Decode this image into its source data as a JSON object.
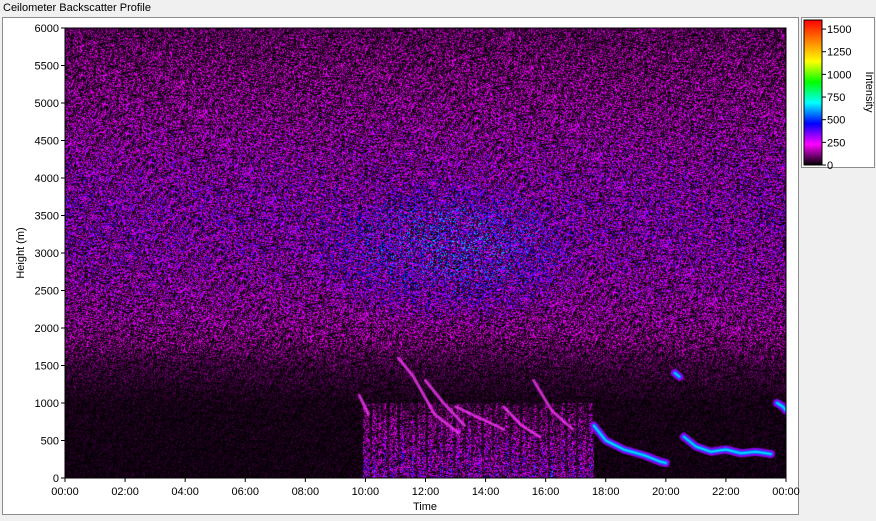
{
  "window": {
    "title": "Ceilometer Backscatter Profile"
  },
  "chart_data": {
    "type": "heatmap",
    "title": "",
    "xlabel": "Time",
    "ylabel": "Height (m)",
    "x_ticks": [
      "00:00",
      "02:00",
      "04:00",
      "06:00",
      "08:00",
      "10:00",
      "12:00",
      "14:00",
      "16:00",
      "18:00",
      "20:00",
      "22:00",
      "00:00"
    ],
    "y_ticks": [
      0,
      500,
      1000,
      1500,
      2000,
      2500,
      3000,
      3500,
      4000,
      4500,
      5000,
      5500,
      6000
    ],
    "xlim": [
      0,
      24
    ],
    "ylim": [
      0,
      6000
    ],
    "grid": false,
    "colorbar": {
      "label": "Intensity",
      "ticks": [
        0,
        250,
        500,
        750,
        1000,
        1250,
        1500
      ],
      "range": [
        0,
        1600
      ],
      "colors": [
        "#000000",
        "#ff00ff",
        "#0000ff",
        "#00ffff",
        "#00ff00",
        "#ffff00",
        "#ff8000",
        "#ff0000"
      ]
    },
    "features": {
      "background_level_by_height": [
        [
          0,
          20
        ],
        [
          1000,
          25
        ],
        [
          1500,
          60
        ],
        [
          2000,
          130
        ],
        [
          2500,
          160
        ],
        [
          3000,
          185
        ],
        [
          3500,
          195
        ],
        [
          4000,
          180
        ],
        [
          5000,
          130
        ],
        [
          6000,
          90
        ]
      ],
      "enhanced_aerosol_region": {
        "x": [
          8.0,
          17.5
        ],
        "y": [
          2000,
          4000
        ],
        "level": 250
      },
      "boundary_layer": {
        "x": [
          9.9,
          17.6
        ],
        "y": [
          0,
          1000
        ],
        "level": 320
      },
      "plume_streaks": [
        [
          [
            9.8,
            1100
          ],
          [
            10.1,
            850
          ]
        ],
        [
          [
            11.1,
            1600
          ],
          [
            11.6,
            1350
          ],
          [
            12.3,
            850
          ],
          [
            13.1,
            600
          ]
        ],
        [
          [
            12.0,
            1300
          ],
          [
            12.6,
            1000
          ],
          [
            13.3,
            700
          ]
        ],
        [
          [
            13.0,
            950
          ],
          [
            13.8,
            800
          ],
          [
            14.6,
            650
          ]
        ],
        [
          [
            14.6,
            950
          ],
          [
            15.2,
            700
          ],
          [
            15.8,
            550
          ]
        ],
        [
          [
            15.6,
            1300
          ],
          [
            16.2,
            900
          ],
          [
            16.9,
            650
          ]
        ]
      ],
      "cloud_layer_traces": [
        [
          [
            17.6,
            700
          ],
          [
            18.0,
            500
          ],
          [
            18.6,
            380
          ],
          [
            19.3,
            300
          ],
          [
            19.8,
            220
          ],
          [
            20.0,
            200
          ]
        ],
        [
          [
            20.6,
            550
          ],
          [
            21.0,
            420
          ],
          [
            21.5,
            350
          ],
          [
            22.0,
            380
          ],
          [
            22.5,
            330
          ],
          [
            23.0,
            350
          ],
          [
            23.5,
            320
          ]
        ],
        [
          [
            23.7,
            1000
          ],
          [
            23.9,
            950
          ],
          [
            24.0,
            900
          ]
        ],
        [
          [
            20.3,
            1400
          ],
          [
            20.45,
            1350
          ]
        ]
      ]
    }
  }
}
